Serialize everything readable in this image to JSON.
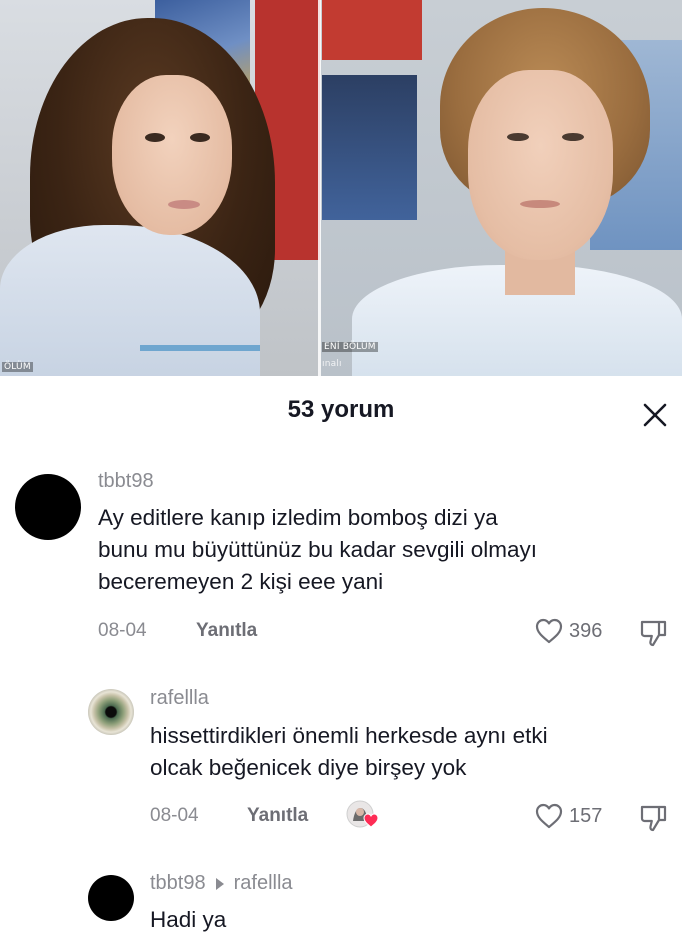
{
  "video": {
    "overlay_left": "ÖLÜM",
    "overlay_right_top": "ENİ BÖLÜM",
    "overlay_right_bottom": "ınalı"
  },
  "sheet": {
    "title": "53 yorum",
    "close_icon": "close-icon"
  },
  "comments": [
    {
      "username": "tbbt98",
      "text_lines": [
        "Ay editlere kanıp izledim bomboş dizi ya",
        "bunu mu büyüttünüz bu kadar sevgili olmayı",
        "beceremeyen 2 kişi eee yani"
      ],
      "date": "08-04",
      "reply_label": "Yanıtla",
      "likes": "396"
    },
    {
      "username": "rafellla",
      "text_lines": [
        "hissettirdikleri önemli herkesde aynı etki",
        "olcak beğenicek diye birşey yok"
      ],
      "date": "08-04",
      "reply_label": "Yanıtla",
      "likes": "157",
      "liked_by_creator": true
    },
    {
      "username": "tbbt98",
      "reply_to": "rafellla",
      "text_lines": [
        "Hadi ya"
      ]
    }
  ],
  "colors": {
    "text_primary": "#161823",
    "text_secondary": "#8a8b91",
    "creator_heart": "#fe2c55"
  }
}
